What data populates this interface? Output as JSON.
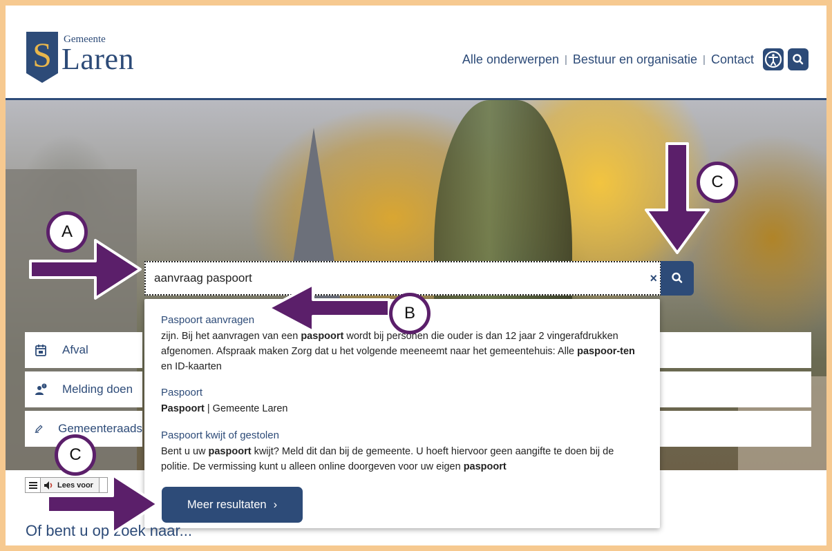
{
  "brand": {
    "small": "Gemeente",
    "big": "Laren",
    "shield_letter": "S"
  },
  "topnav": {
    "items": [
      "Alle onderwerpen",
      "Bestuur en organisatie",
      "Contact"
    ],
    "separator": "|"
  },
  "search": {
    "value": "aanvraag paspoort",
    "clear_symbol": "×"
  },
  "results": [
    {
      "title": "Paspoort aanvragen",
      "snippet": [
        {
          "t": "zijn. Bij het aanvragen van een ",
          "b": false
        },
        {
          "t": "paspoort",
          "b": true
        },
        {
          "t": " wordt bij personen die ouder is dan 12 jaar 2 vingerafdrukken afgenomen. Afspraak maken Zorg dat u het volgende meeneemt naar het gemeentehuis: Alle ",
          "b": false
        },
        {
          "t": "paspoor-ten",
          "b": true
        },
        {
          "t": " en ID-kaarten",
          "b": false
        }
      ]
    },
    {
      "title": "Paspoort",
      "snippet": [
        {
          "t": "Paspoort",
          "b": true
        },
        {
          "t": " | Gemeente Laren",
          "b": false
        }
      ]
    },
    {
      "title": "Paspoort kwijt of gestolen",
      "snippet": [
        {
          "t": "Bent u uw ",
          "b": false
        },
        {
          "t": "paspoort",
          "b": true
        },
        {
          "t": " kwijt? Meld dit dan bij de gemeente. U hoeft hiervoor geen aangifte te doen bij de politie. De vermissing kunt u alleen online doorgeven voor uw eigen ",
          "b": false
        },
        {
          "t": "paspoort",
          "b": true
        }
      ]
    }
  ],
  "more_button": {
    "label": "Meer resultaten",
    "chevron": "›"
  },
  "quicklinks": [
    {
      "label": "Afval",
      "icon": "calendar-icon"
    },
    {
      "label": "Melding doen",
      "icon": "person-alert-icon"
    },
    {
      "label": "Gemeenteraads",
      "icon": "pencil-icon"
    }
  ],
  "readbar": {
    "label": "Lees voor"
  },
  "section_title": "Of bent u op zoek naar...",
  "annotations": {
    "a": "A",
    "b": "B",
    "c": "C"
  },
  "colors": {
    "brand": "#2d4b78",
    "annotation": "#5b1f6a",
    "frame": "#f6c990",
    "gold": "#e8b64c"
  }
}
